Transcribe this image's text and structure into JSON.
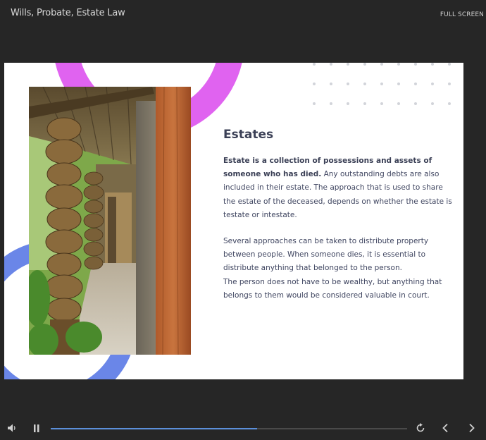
{
  "header": {
    "title": "Wills, Probate, Estate Law",
    "fullscreen_label": "FULL SCREEN"
  },
  "slide": {
    "heading": "Estates",
    "paragraph1_bold": "Estate is a collection of possessions and assets of someone who has died.",
    "paragraph1_rest": " Any outstanding debts are also included in their estate. The approach that is used to share the estate of the deceased, depends on whether the estate is testate or intestate.",
    "paragraph2": "Several approaches can be taken to distribute property between people. When someone dies, it is essential to distribute anything that belonged to the person.",
    "paragraph3": "The person does not have to be wealthy, but anything that belongs to them would be considered valuable in court."
  },
  "player": {
    "progress": 0.58,
    "icons": {
      "volume": "volume-icon",
      "pause": "pause-icon",
      "replay": "replay-icon",
      "previous": "chevron-left-icon",
      "next": "chevron-right-icon"
    }
  },
  "colors": {
    "background": "#262626",
    "slide": "#ffffff",
    "accent_magenta": "#e063f0",
    "accent_blue": "#6a86e8",
    "progress": "#5b8fd9",
    "heading": "#3b4056"
  }
}
